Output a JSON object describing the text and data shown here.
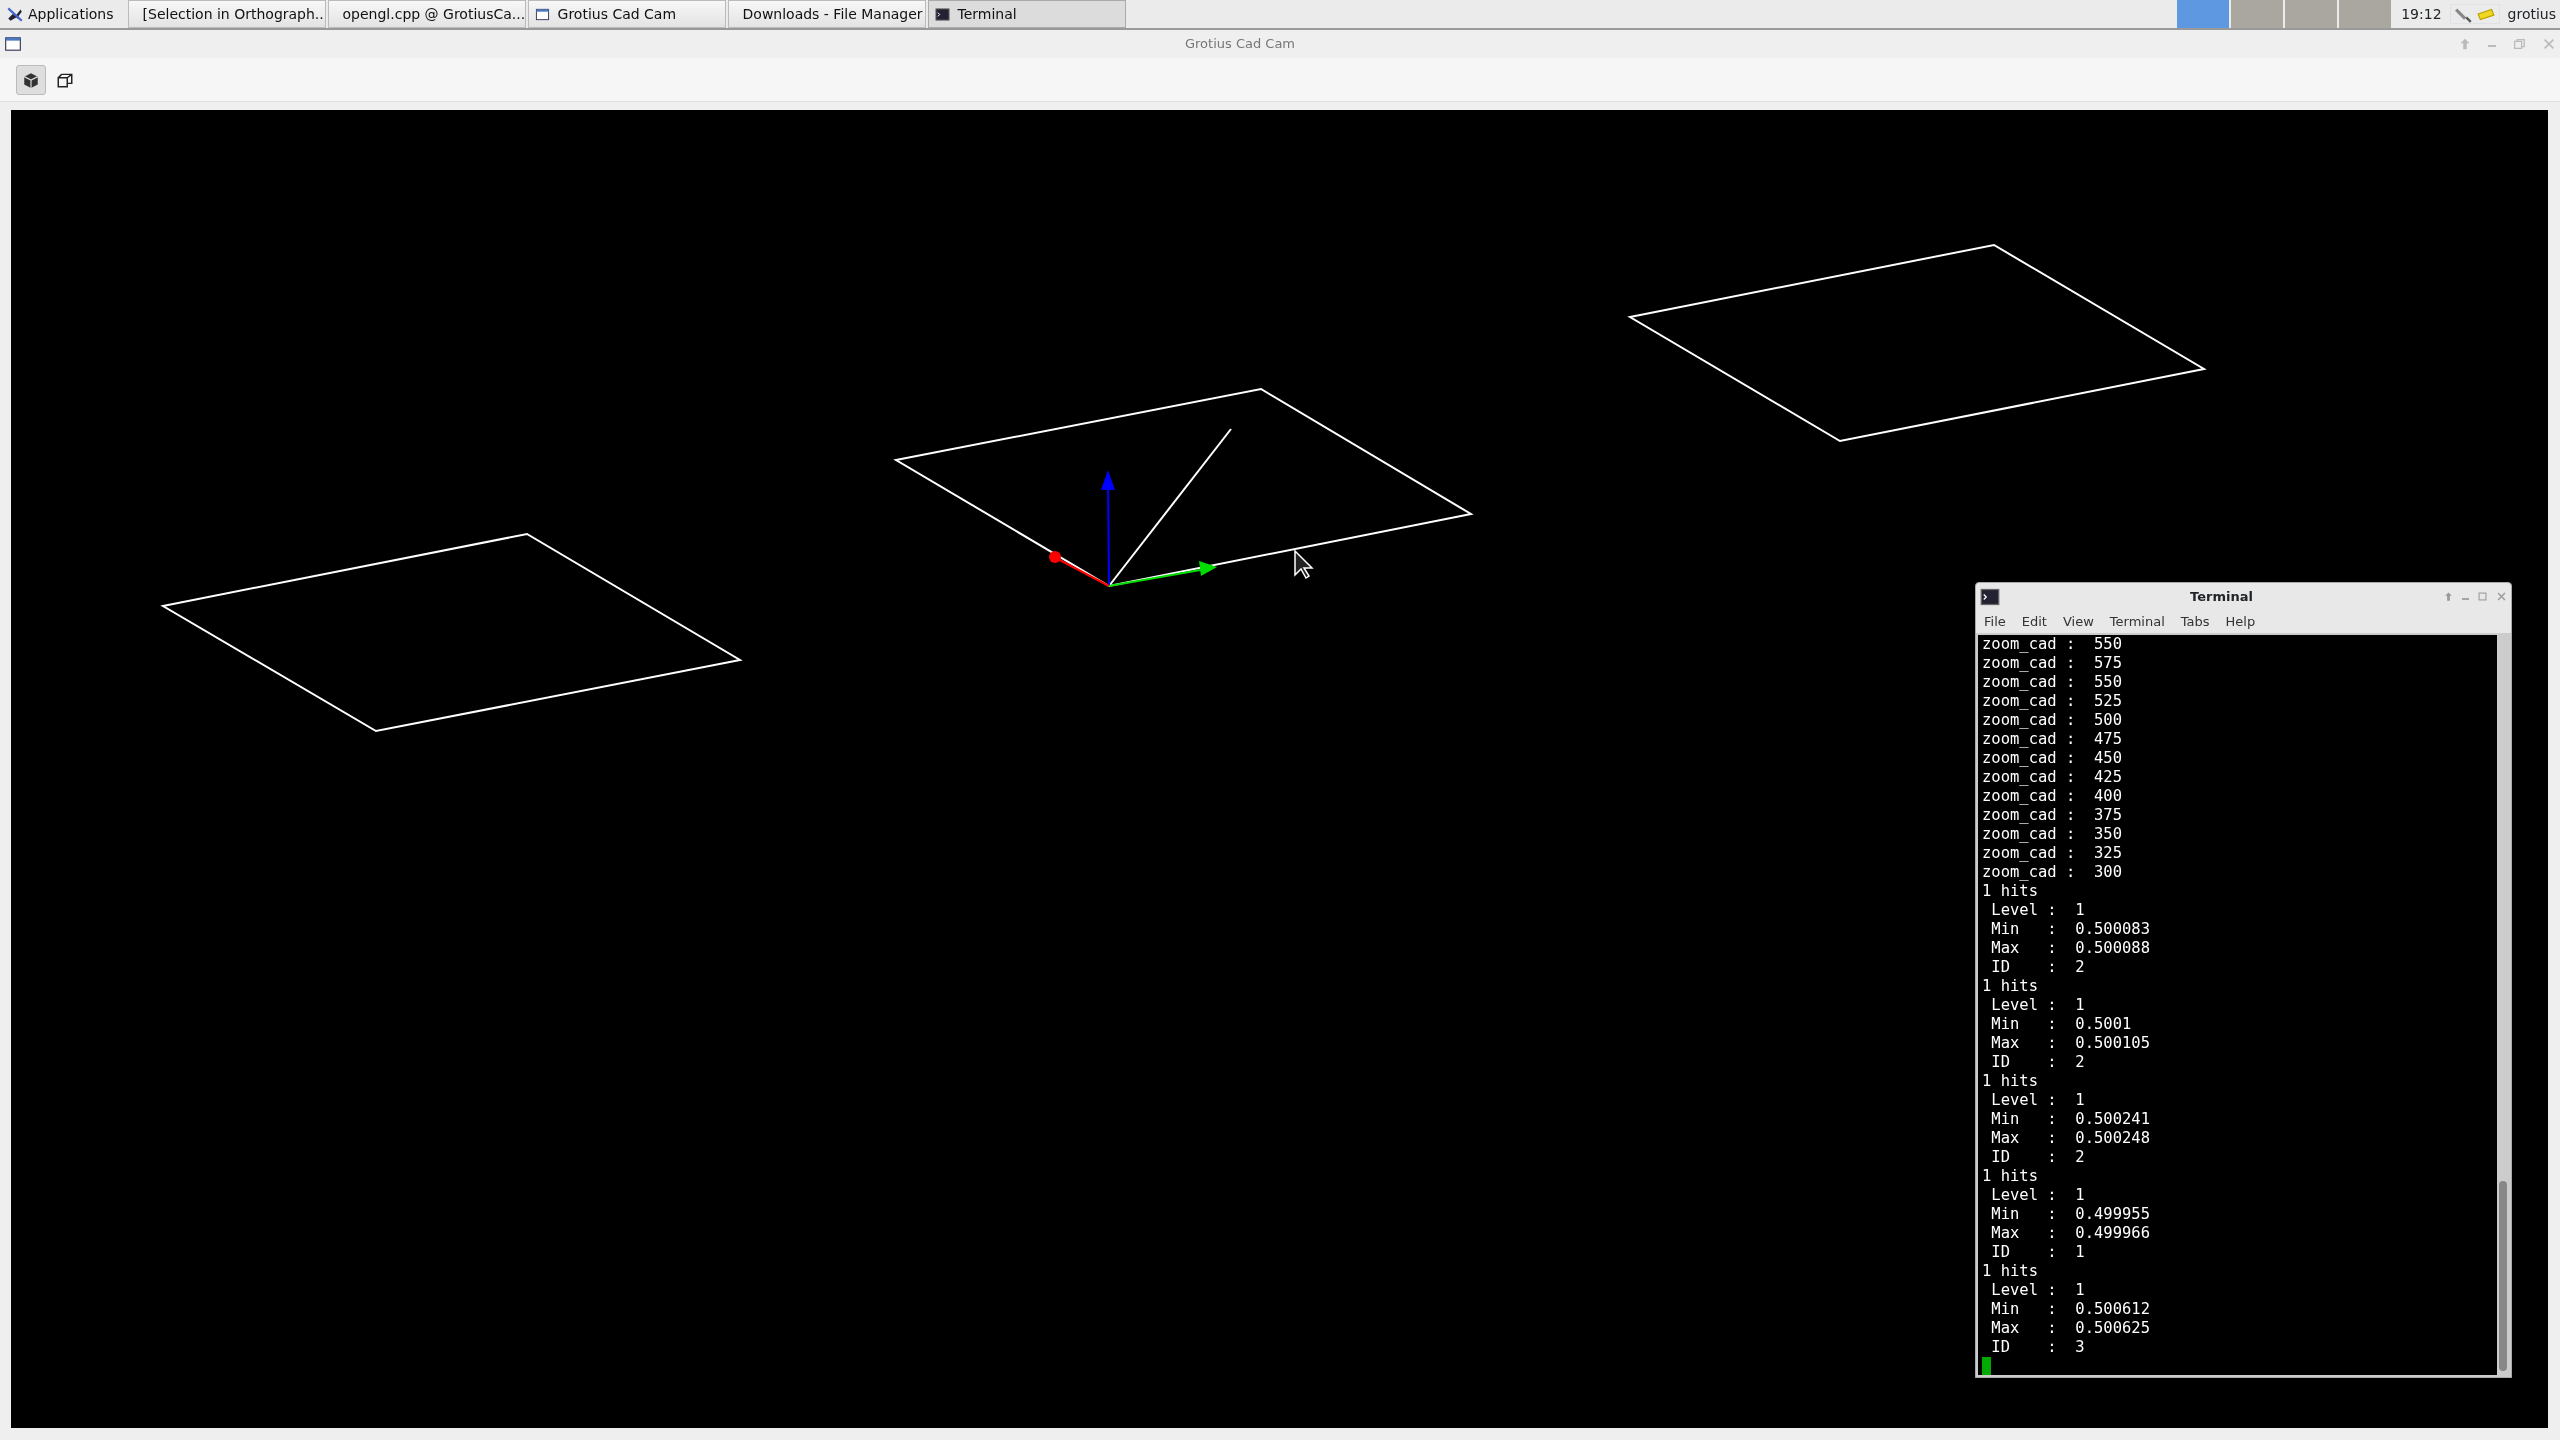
{
  "taskbar": {
    "menu_button": "Applications",
    "tasks": [
      {
        "label": "[Selection in Orthograph...",
        "kind": "browser",
        "selected": false
      },
      {
        "label": "opengl.cpp @ GrotiusCa...",
        "kind": "editor",
        "selected": false
      },
      {
        "label": "Grotius Cad Cam",
        "kind": "window",
        "selected": false
      },
      {
        "label": "Downloads - File Manager",
        "kind": "folder",
        "selected": false
      },
      {
        "label": "Terminal",
        "kind": "terminal",
        "selected": true
      }
    ],
    "workspaces": [
      {
        "selected": true
      },
      {
        "selected": false
      },
      {
        "selected": false
      },
      {
        "selected": false
      }
    ],
    "clock": "19:12",
    "user": "grotius"
  },
  "window": {
    "title": "Grotius Cad Cam"
  },
  "toolbar": [
    {
      "kind": "solid",
      "selected": true
    },
    {
      "kind": "wireframe",
      "selected": false
    }
  ],
  "terminal": {
    "title": "Terminal",
    "menu": [
      "File",
      "Edit",
      "View",
      "Terminal",
      "Tabs",
      "Help"
    ],
    "lines": [
      "zoom_cad :  550",
      "zoom_cad :  575",
      "zoom_cad :  550",
      "zoom_cad :  525",
      "zoom_cad :  500",
      "zoom_cad :  475",
      "zoom_cad :  450",
      "zoom_cad :  425",
      "zoom_cad :  400",
      "zoom_cad :  375",
      "zoom_cad :  350",
      "zoom_cad :  325",
      "zoom_cad :  300",
      "1 hits",
      " Level :  1",
      " Min   :  0.500083",
      " Max   :  0.500088",
      " ID    :  2",
      "1 hits",
      " Level :  1",
      " Min   :  0.5001",
      " Max   :  0.500105",
      " ID    :  2",
      "1 hits",
      " Level :  1",
      " Min   :  0.500241",
      " Max   :  0.500248",
      " ID    :  2",
      "1 hits",
      " Level :  1",
      " Min   :  0.499955",
      " Max   :  0.499966",
      " ID    :  1",
      "1 hits",
      " Level :  1",
      " Min   :  0.500612",
      " Max   :  0.500625",
      " ID    :  3"
    ]
  }
}
